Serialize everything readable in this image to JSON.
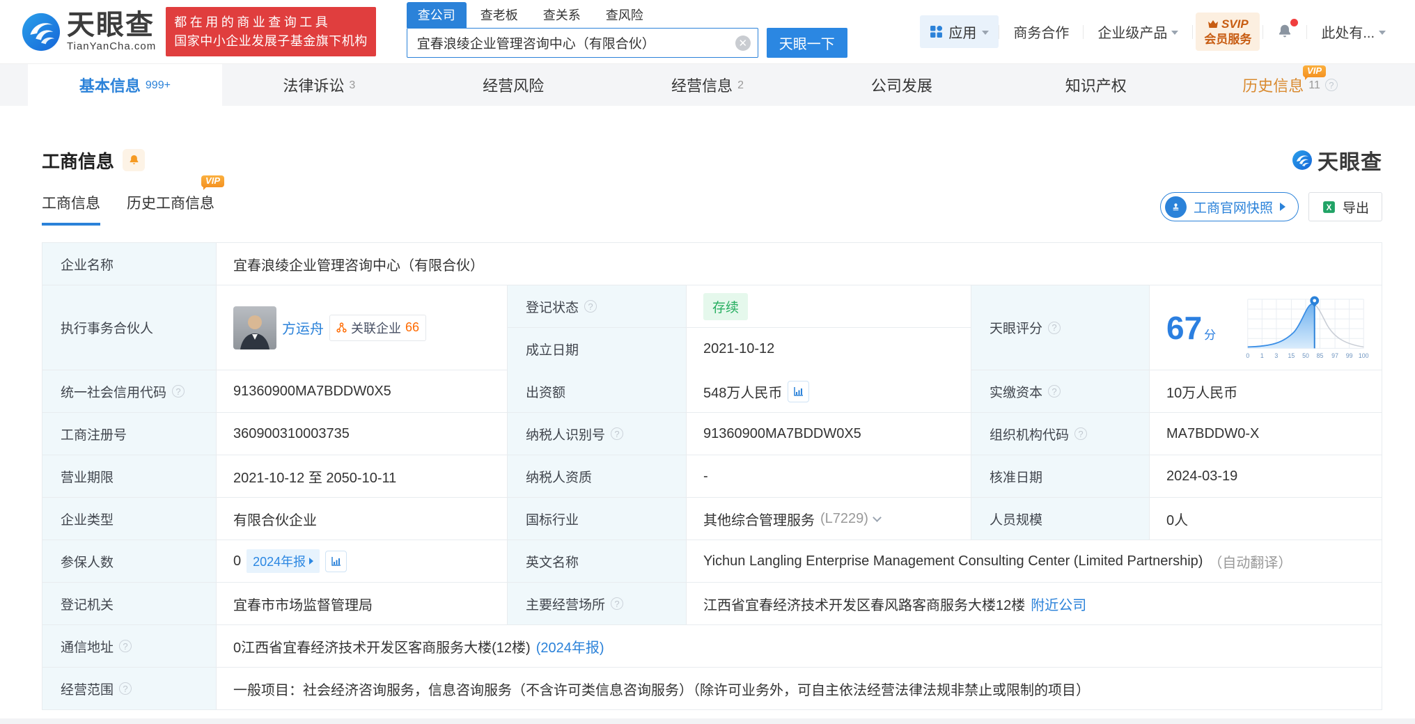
{
  "header": {
    "brand": "天眼查",
    "brand_domain": "TianYanCha.com",
    "promo_line1": "都在用的商业查询工具",
    "promo_line2": "国家中小企业发展子基金旗下机构",
    "search_tabs": [
      {
        "label": "查公司"
      },
      {
        "label": "查老板"
      },
      {
        "label": "查关系"
      },
      {
        "label": "查风险"
      }
    ],
    "search_value": "宜春浪绫企业管理咨询中心（有限合伙）",
    "search_button": "天眼一下",
    "apps_label": "应用",
    "biz_label": "商务合作",
    "enterprise_label": "企业级产品",
    "svip_line1": "SVIP",
    "svip_line2": "会员服务",
    "user_label": "此处有..."
  },
  "nav": {
    "tabs": [
      {
        "label": "基本信息",
        "count": "999+"
      },
      {
        "label": "法律诉讼",
        "count": "3"
      },
      {
        "label": "经营风险",
        "count": ""
      },
      {
        "label": "经营信息",
        "count": "2"
      },
      {
        "label": "公司发展",
        "count": ""
      },
      {
        "label": "知识产权",
        "count": ""
      },
      {
        "label": "历史信息",
        "count": "11"
      }
    ],
    "vip": "VIP"
  },
  "section": {
    "title": "工商信息",
    "watermark_brand": "天眼查",
    "subtab_active": "工商信息",
    "subtab_history": "历史工商信息",
    "vip": "VIP",
    "snapshot_button": "工商官网快照",
    "export_button": "导出"
  },
  "table": {
    "company_name": {
      "label": "企业名称",
      "value": "宜春浪绫企业管理咨询中心（有限合伙）"
    },
    "partner": {
      "label": "执行事务合伙人",
      "name": "方运舟",
      "related_label": "关联企业",
      "related_count": "66"
    },
    "reg_status": {
      "label": "登记状态",
      "value": "存续"
    },
    "establish_date": {
      "label": "成立日期",
      "value": "2021-10-12"
    },
    "score": {
      "label": "天眼评分",
      "value": "67",
      "unit": "分",
      "axis": [
        "0",
        "1",
        "3",
        "15",
        "50",
        "85",
        "97",
        "99",
        "100"
      ]
    },
    "credit_code": {
      "label": "统一社会信用代码",
      "value": "91360900MA7BDDW0X5"
    },
    "capital": {
      "label": "出资额",
      "value": "548万人民币"
    },
    "paid_capital": {
      "label": "实缴资本",
      "value": "10万人民币"
    },
    "reg_number": {
      "label": "工商注册号",
      "value": "360900310003735"
    },
    "taxpayer_id": {
      "label": "纳税人识别号",
      "value": "91360900MA7BDDW0X5"
    },
    "org_code": {
      "label": "组织机构代码",
      "value": "MA7BDDW0-X"
    },
    "business_term": {
      "label": "营业期限",
      "value": "2021-10-12 至 2050-10-11"
    },
    "taxpayer_qualification": {
      "label": "纳税人资质",
      "value": "-"
    },
    "approval_date": {
      "label": "核准日期",
      "value": "2024-03-19"
    },
    "company_type": {
      "label": "企业类型",
      "value": "有限合伙企业"
    },
    "industry": {
      "label": "国标行业",
      "value": "其他综合管理服务",
      "code": "(L7229)"
    },
    "staff_size": {
      "label": "人员规模",
      "value": "0人"
    },
    "insured_count": {
      "label": "参保人数",
      "value": "0",
      "report_badge": "2024年报"
    },
    "english_name": {
      "label": "英文名称",
      "value": "Yichun Langling Enterprise Management Consulting Center (Limited Partnership)",
      "note": "（自动翻译）"
    },
    "reg_authority": {
      "label": "登记机关",
      "value": "宜春市市场监督管理局"
    },
    "main_location": {
      "label": "主要经营场所",
      "value": "江西省宜春经济技术开发区春风路客商服务大楼12楼",
      "link": "附近公司"
    },
    "address": {
      "label": "通信地址",
      "value": "0江西省宜春经济技术开发区客商服务大楼(12楼)",
      "link": "(2024年报)"
    },
    "business_scope": {
      "label": "经营范围",
      "value": "一般项目：社会经济咨询服务，信息咨询服务（不含许可类信息咨询服务）（除许可业务外，可自主依法经营法律法规非禁止或限制的项目）"
    }
  },
  "colors": {
    "primary_blue": "#2b82d9",
    "orange": "#f59b2c",
    "green": "#27ae60",
    "red_banner": "#e03e3e"
  }
}
